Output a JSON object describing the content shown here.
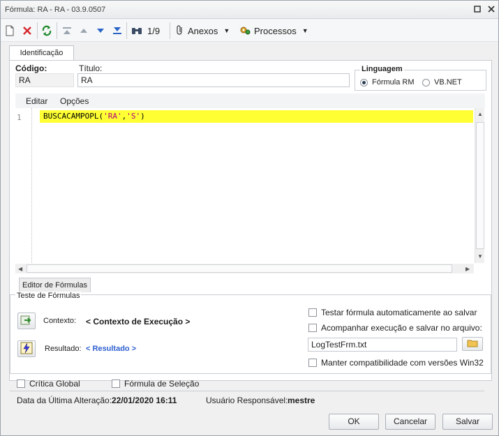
{
  "window": {
    "title": "Fórmula: RA - RA - 03.9.0507"
  },
  "toolbar": {
    "record_position": "1/9",
    "anexos_label": "Anexos",
    "processos_label": "Processos"
  },
  "tabs": {
    "main": "Identificação",
    "editor": "Editor de Fórmulas"
  },
  "form": {
    "codigo_label": "Código:",
    "codigo_value": "RA",
    "titulo_label": "Título:",
    "titulo_value": "RA",
    "linguagem_label": "Linguagem",
    "linguagem_options": [
      "Fórmula RM",
      "VB.NET"
    ],
    "linguagem_selected": "Fórmula RM"
  },
  "editor": {
    "menu": [
      "Editar",
      "Opções"
    ],
    "line_number": "1",
    "code_prefix": "BUSCACAMPOPL(",
    "code_str1": "'RA'",
    "code_comma": ",",
    "code_str2": "'S'",
    "code_suffix": ")",
    "highlight_color": "#ffff34"
  },
  "teste": {
    "group_label": "Teste de Fórmulas",
    "contexto_label": "Contexto:",
    "contexto_link": "< Contexto de Execução >",
    "resultado_label": "Resultado:",
    "resultado_link": "< Resultado >",
    "check_auto": "Testar fórmula automaticamente ao salvar",
    "check_acompanhar": "Acompanhar execução e salvar no arquivo:",
    "log_file": "LogTestFrm.txt",
    "check_win32": "Manter compatibilidade com versões Win32"
  },
  "options": {
    "critica_global": "Crítica Global",
    "formula_selecao": "Fórmula de Seleção"
  },
  "status": {
    "data_label": "Data da Última Alteração:",
    "data_value": "22/01/2020 16:11",
    "usuario_label": "Usuário Responsável:",
    "usuario_value": "mestre"
  },
  "buttons": {
    "ok": "OK",
    "cancelar": "Cancelar",
    "salvar": "Salvar"
  },
  "colors": {
    "link_contexto": "#1a1a1a",
    "link_resultado": "#2f5fd0",
    "accent": "#2f5fd0"
  }
}
